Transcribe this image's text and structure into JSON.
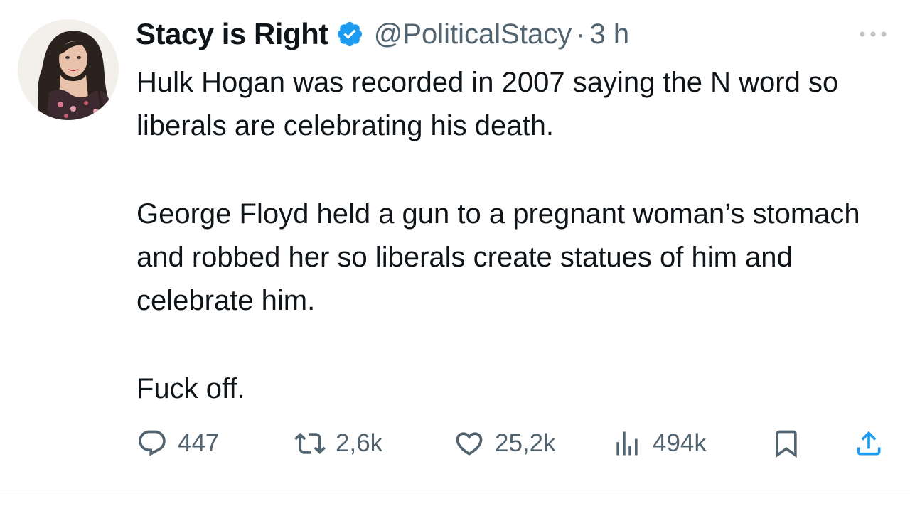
{
  "author": {
    "display_name": "Stacy is Right",
    "handle": "@PoliticalStacy",
    "time_separator": "·",
    "time": "3 h",
    "verified": true,
    "verified_color": "#1d9bf0"
  },
  "tweet": {
    "paragraphs": [
      "Hulk Hogan was recorded in 2007 saying the N word so liberals are celebrating his death.",
      "George Floyd held a gun to a pregnant woman’s stomach and robbed her so liberals create statues of him and celebrate him.",
      "Fuck off."
    ]
  },
  "actions": {
    "replies": "447",
    "reposts": "2,6k",
    "likes": "25,2k",
    "views": "494k"
  },
  "icons": {
    "reply": "reply-icon",
    "repost": "repost-icon",
    "like": "heart-icon",
    "views": "views-icon",
    "bookmark": "bookmark-icon",
    "share": "share-icon",
    "more": "more-icon",
    "verified": "verified-badge-icon"
  },
  "colors": {
    "text": "#0f1419",
    "secondary": "#536471",
    "divider": "#e1e4e8"
  }
}
